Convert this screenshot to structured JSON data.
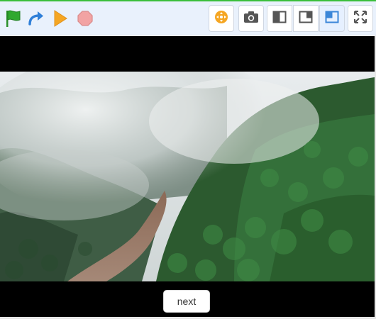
{
  "toolbar": {
    "left_buttons": [
      {
        "name": "green-flag-icon",
        "color": "#2fa82f"
      },
      {
        "name": "redo-arrow-icon",
        "color": "#2f7fd8"
      },
      {
        "name": "play-triangle-icon",
        "color": "#f5a623"
      },
      {
        "name": "stop-octagon-icon",
        "color": "#f2a3a3"
      }
    ],
    "right_buttons": [
      {
        "name": "move-target-icon",
        "color": "#f5a623"
      },
      {
        "name": "camera-icon",
        "color": "#555555"
      },
      {
        "name": "small-stage-icon",
        "color": "#555555"
      },
      {
        "name": "medium-stage-icon",
        "color": "#555555"
      },
      {
        "name": "large-stage-icon",
        "color": "#3b86d8",
        "active": true
      },
      {
        "name": "fullscreen-icon",
        "color": "#555555"
      }
    ]
  },
  "stage": {
    "background": "#000000",
    "video_scene": "misty-rainforest-river"
  },
  "next_button": {
    "label": "next"
  }
}
